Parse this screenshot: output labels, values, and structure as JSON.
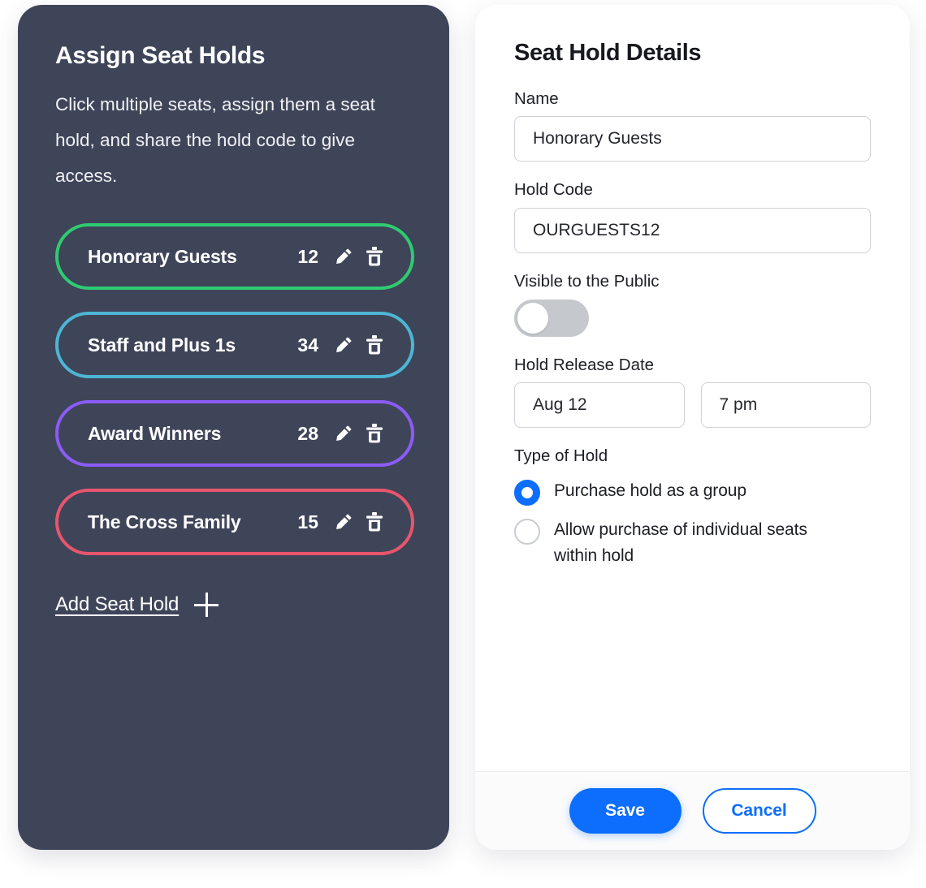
{
  "left_panel": {
    "title": "Assign Seat Holds",
    "description": "Click multiple seats, assign them a seat hold, and share the hold code to give access.",
    "holds": [
      {
        "name": "Honorary Guests",
        "count": "12",
        "color": "#2ecc71",
        "edit_icon": "pencil-icon",
        "delete_icon": "trash-icon"
      },
      {
        "name": "Staff and Plus 1s",
        "count": "34",
        "color": "#4db6d4",
        "edit_icon": "pencil-icon",
        "delete_icon": "trash-icon"
      },
      {
        "name": "Award Winners",
        "count": "28",
        "color": "#8b5cf6",
        "edit_icon": "pencil-icon",
        "delete_icon": "trash-icon"
      },
      {
        "name": "The Cross Family",
        "count": "15",
        "color": "#e8556d",
        "edit_icon": "pencil-icon",
        "delete_icon": "trash-icon"
      }
    ],
    "add_hold_label": "Add Seat Hold",
    "add_hold_icon": "plus-icon"
  },
  "right_panel": {
    "title": "Seat Hold Details",
    "name_label": "Name",
    "name_value": "Honorary Guests",
    "hold_code_label": "Hold Code",
    "hold_code_value": "OURGUESTS12",
    "visible_label": "Visible to the Public",
    "visible_state": "off",
    "release_date_label": "Hold Release Date",
    "release_date_value": "Aug 12",
    "release_time_value": "7 pm",
    "type_label": "Type of Hold",
    "type_options": [
      {
        "label": "Purchase hold as a group",
        "selected": true
      },
      {
        "label": "Allow purchase of individual seats within hold",
        "selected": false
      }
    ],
    "save_label": "Save",
    "cancel_label": "Cancel"
  },
  "colors": {
    "panel_dark": "#3f4559",
    "accent_blue": "#0d6efd",
    "toggle_off": "#c5c9cd"
  }
}
